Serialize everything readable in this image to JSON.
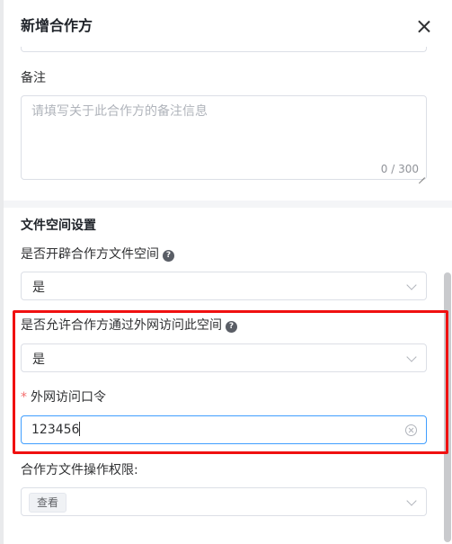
{
  "dialog": {
    "title": "新增合作方"
  },
  "remark": {
    "label": "备注",
    "placeholder": "请填写关于此合作方的备注信息",
    "counter": "0 / 300"
  },
  "file_space": {
    "section_title": "文件空间设置",
    "enable_label": "是否开辟合作方文件空间",
    "enable_value": "是",
    "external_label": "是否允许合作方通过外网访问此空间",
    "external_value": "是",
    "password_required_mark": "*",
    "password_label": "外网访问口令",
    "password_value": "123456",
    "permission_label": "合作方文件操作权限:",
    "permission_tags": [
      "查看"
    ]
  },
  "icons": {
    "close": "close-icon",
    "help": "question-circle-icon",
    "chevron": "chevron-down-icon",
    "clear": "clear-circle-icon"
  },
  "colors": {
    "highlight": "#f01010",
    "focus_border": "#409eff",
    "required": "#f56c6c"
  }
}
